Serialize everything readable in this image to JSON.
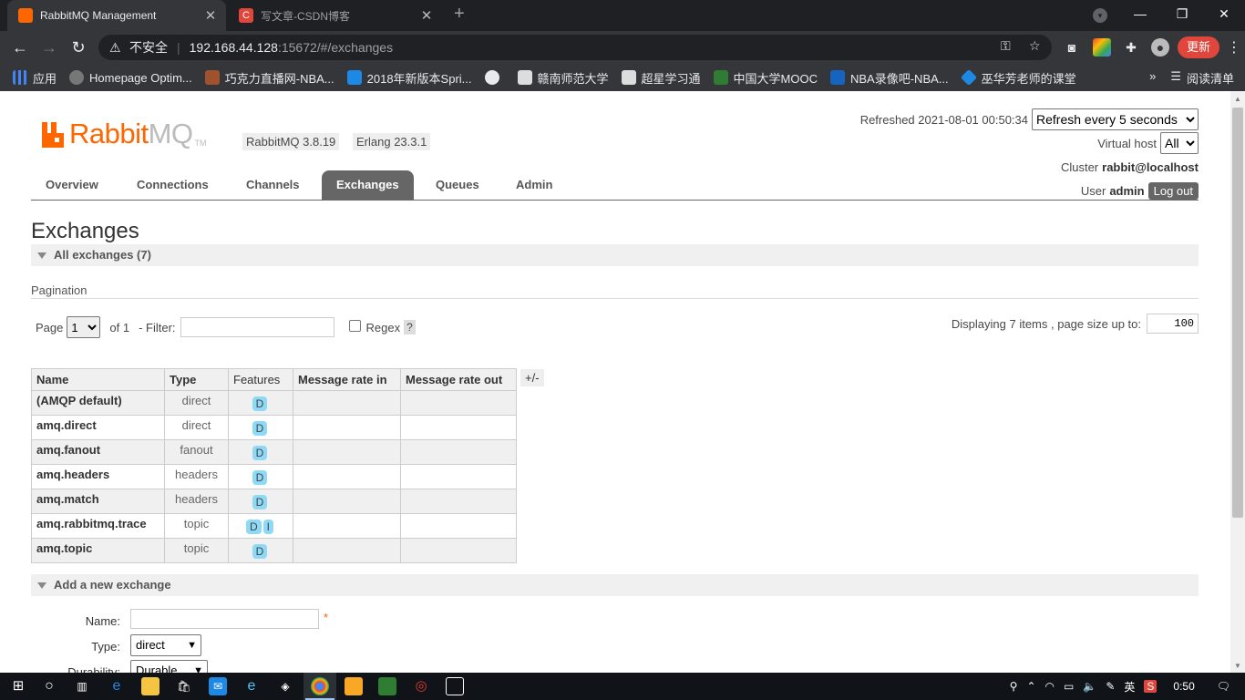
{
  "browser": {
    "active_tab_title": "RabbitMQ Management",
    "inactive_tab_title": "写文章-CSDN博客",
    "url_warning": "不安全",
    "url_host": "192.168.44.128",
    "url_path": ":15672/#/exchanges",
    "update_label": "更新",
    "bookmarks": [
      {
        "label": "应用",
        "color": "#4285f4"
      },
      {
        "label": "Homepage Optim...",
        "color": "#777"
      },
      {
        "label": "巧克力直播网-NBA...",
        "color": "#a0522d"
      },
      {
        "label": "2018年新版本Spri...",
        "color": "#1e88e5"
      },
      {
        "label": "",
        "color": "#e8eaed"
      },
      {
        "label": "赣南师范大学",
        "color": "#ddd"
      },
      {
        "label": "超星学习通",
        "color": "#ddd"
      },
      {
        "label": "中国大学MOOC",
        "color": "#2e7d32"
      },
      {
        "label": "NBA录像吧-NBA...",
        "color": "#1565c0"
      },
      {
        "label": "巫华芳老师的课堂",
        "color": "#1e88e5"
      }
    ],
    "reading_list": "阅读清单"
  },
  "header": {
    "versions": [
      "RabbitMQ 3.8.19",
      "Erlang 23.3.1"
    ],
    "refreshed": "Refreshed 2021-08-01 00:50:34",
    "refresh_select": "Refresh every 5 seconds",
    "vhost_label": "Virtual host",
    "vhost_select": "All",
    "cluster_label": "Cluster",
    "cluster_value": "rabbit@localhost",
    "user_label": "User",
    "user_value": "admin",
    "logout_label": "Log out"
  },
  "nav": [
    "Overview",
    "Connections",
    "Channels",
    "Exchanges",
    "Queues",
    "Admin"
  ],
  "page_title": "Exchanges",
  "all_exchanges_label": "All exchanges (7)",
  "pagination": {
    "label": "Pagination",
    "page_label": "Page",
    "page_value": "1",
    "of_label": "of 1",
    "filter_label": "- Filter:",
    "filter_value": "",
    "regex_label": "Regex",
    "help": "?",
    "display_info": "Displaying 7 items , page size up to:",
    "page_size": "100"
  },
  "table": {
    "headers": [
      "Name",
      "Type",
      "Features",
      "Message rate in",
      "Message rate out"
    ],
    "plus_minus": "+/-",
    "rows": [
      {
        "name": "(AMQP default)",
        "type": "direct",
        "features": [
          "D"
        ]
      },
      {
        "name": "amq.direct",
        "type": "direct",
        "features": [
          "D"
        ]
      },
      {
        "name": "amq.fanout",
        "type": "fanout",
        "features": [
          "D"
        ]
      },
      {
        "name": "amq.headers",
        "type": "headers",
        "features": [
          "D"
        ]
      },
      {
        "name": "amq.match",
        "type": "headers",
        "features": [
          "D"
        ]
      },
      {
        "name": "amq.rabbitmq.trace",
        "type": "topic",
        "features": [
          "D",
          "I"
        ]
      },
      {
        "name": "amq.topic",
        "type": "topic",
        "features": [
          "D"
        ]
      }
    ]
  },
  "add_exchange": {
    "title": "Add a new exchange",
    "name_label": "Name:",
    "required_mark": "*",
    "type_label": "Type:",
    "type_value": "direct",
    "durability_label": "Durability:",
    "durability_value": "Durable"
  },
  "taskbar": {
    "ime": "英",
    "clock": "0:50"
  },
  "colors": {
    "brand_orange": "#ff6600",
    "nav_active": "#666666",
    "feature_badge": "#8ed9f5"
  }
}
